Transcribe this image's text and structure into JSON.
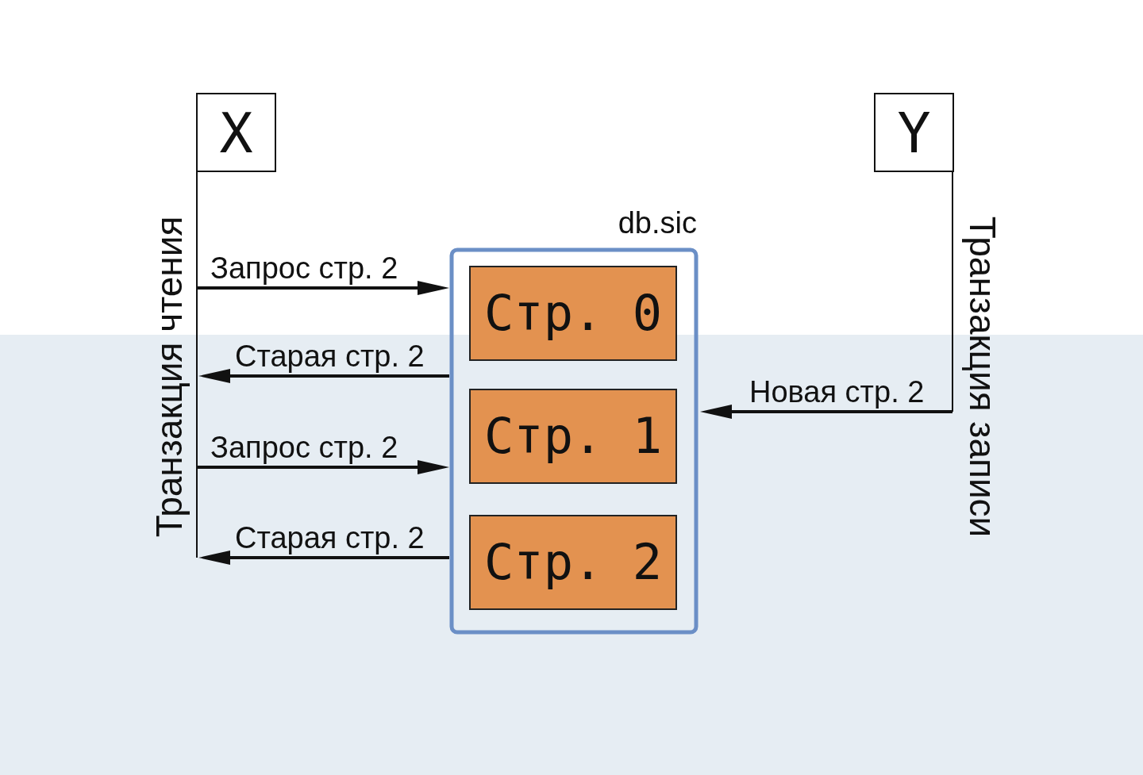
{
  "actors": [
    {
      "label": "X",
      "transaction": "Транзакция чтения",
      "messages": [
        {
          "label": "Запрос стр. 2",
          "kind": "to_db"
        },
        {
          "label": "Старая стр. 2",
          "kind": "from_db"
        },
        {
          "label": "Запрос стр. 2",
          "kind": "to_db"
        },
        {
          "label": "Старая стр. 2",
          "kind": "from_db"
        }
      ]
    },
    {
      "label": "Y",
      "transaction": "Транзакция записи",
      "messages": [
        {
          "label": "Новая стр. 2",
          "kind": "to_db"
        }
      ]
    }
  ],
  "database": {
    "name": "db.sic",
    "pages": [
      "Стр. 0",
      "Стр. 1",
      "Стр. 2"
    ]
  }
}
